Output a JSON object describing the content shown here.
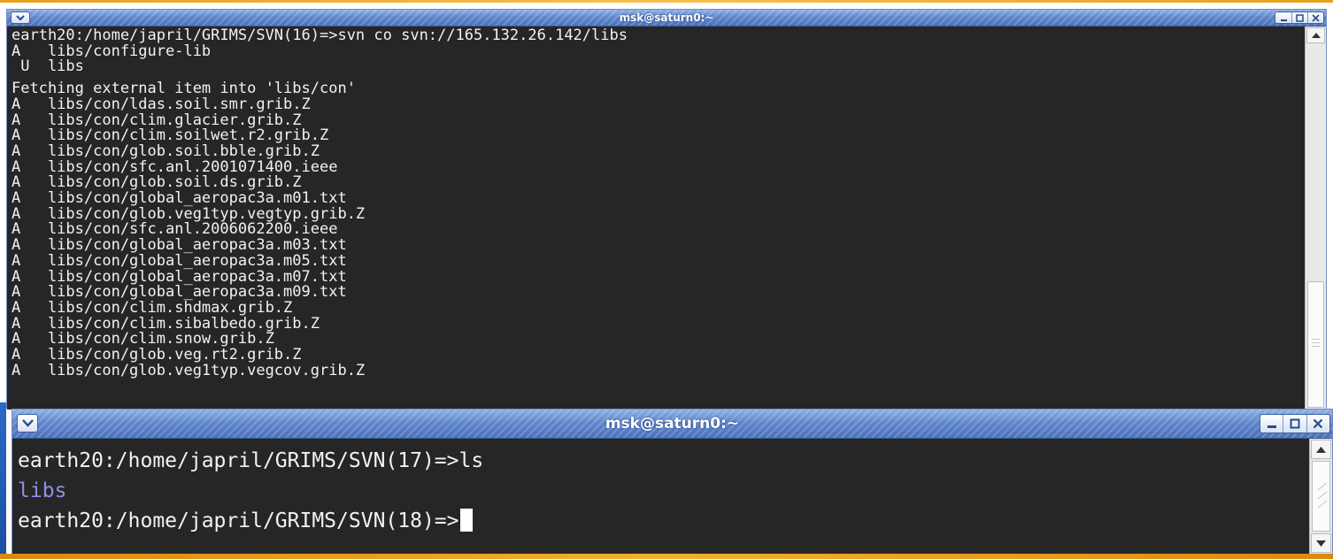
{
  "window_top": {
    "title": "msk@saturn0:~",
    "lines": [
      "earth20:/home/japril/GRIMS/SVN(16)=>svn co svn://165.132.26.142/libs",
      "A   libs/configure-lib",
      " U  libs",
      "",
      "Fetching external item into 'libs/con'",
      "A   libs/con/ldas.soil.smr.grib.Z",
      "A   libs/con/clim.glacier.grib.Z",
      "A   libs/con/clim.soilwet.r2.grib.Z",
      "A   libs/con/glob.soil.bble.grib.Z",
      "A   libs/con/sfc.anl.2001071400.ieee",
      "A   libs/con/glob.soil.ds.grib.Z",
      "A   libs/con/global_aeropac3a.m01.txt",
      "A   libs/con/glob.veg1typ.vegtyp.grib.Z",
      "A   libs/con/sfc.anl.2006062200.ieee",
      "A   libs/con/global_aeropac3a.m03.txt",
      "A   libs/con/global_aeropac3a.m05.txt",
      "A   libs/con/global_aeropac3a.m07.txt",
      "A   libs/con/global_aeropac3a.m09.txt",
      "A   libs/con/clim.shdmax.grib.Z",
      "A   libs/con/clim.sibalbedo.grib.Z",
      "A   libs/con/clim.snow.grib.Z",
      "A   libs/con/glob.veg.rt2.grib.Z",
      "A   libs/con/glob.veg1typ.vegcov.grib.Z"
    ]
  },
  "window_bottom": {
    "title": "msk@saturn0:~",
    "line1": "earth20:/home/japril/GRIMS/SVN(17)=>ls",
    "line2": "libs",
    "line3": "earth20:/home/japril/GRIMS/SVN(18)=>"
  },
  "colors": {
    "terminal_bg": "#262626",
    "terminal_fg": "#f2f2f2",
    "directory": "#8f8fe8",
    "titlebar": "#5f86cc"
  },
  "icons": {
    "window_menu": "chevron-down-icon",
    "minimize": "minimize-icon",
    "maximize": "maximize-icon",
    "close": "close-icon",
    "scroll_up": "arrow-up-icon",
    "scroll_down": "arrow-down-icon"
  }
}
